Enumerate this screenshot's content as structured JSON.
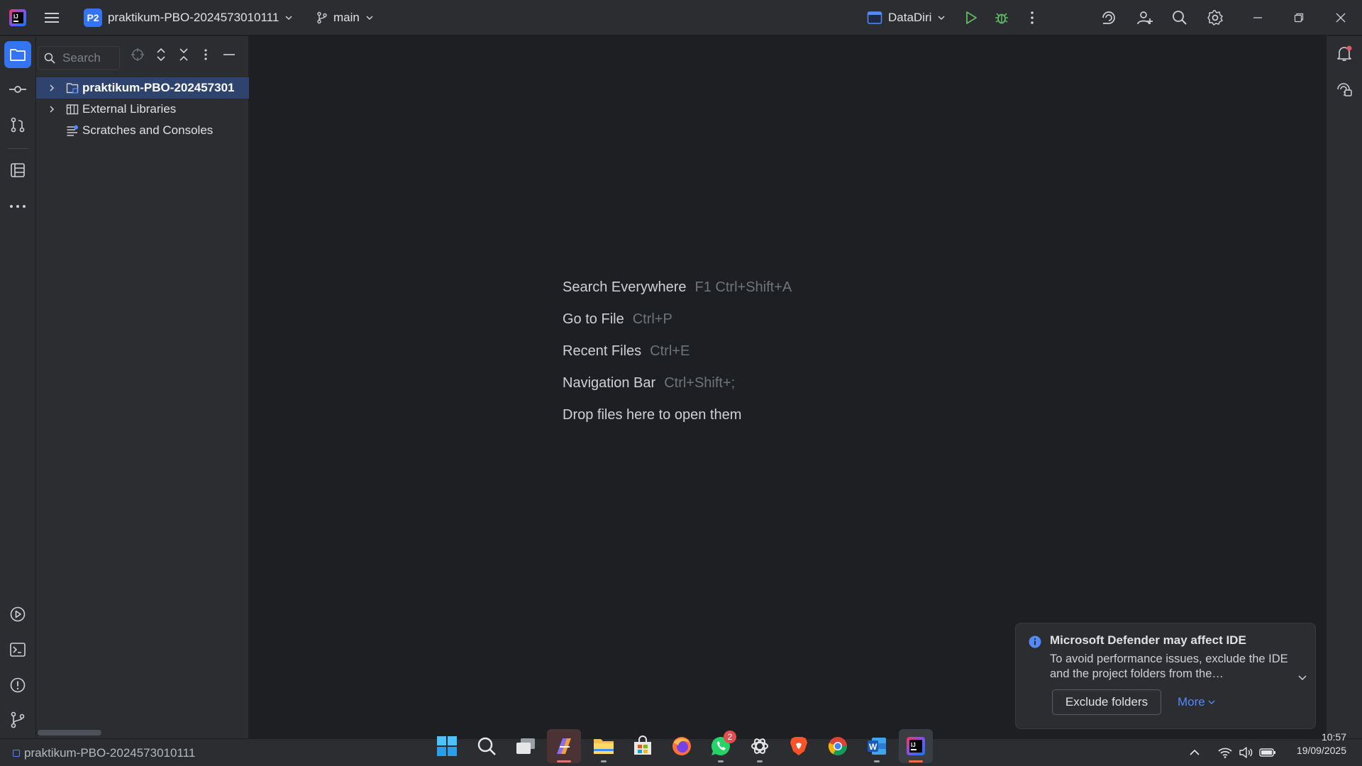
{
  "titlebar": {
    "project_badge": "P2",
    "project_name": "praktikum-PBO-2024573010111",
    "branch": "main",
    "run_config": "DataDiri"
  },
  "project_panel": {
    "search_placeholder": "Search",
    "tree": [
      {
        "label": "praktikum-PBO-202457301",
        "icon": "module-folder-icon",
        "expandable": true,
        "selected": true
      },
      {
        "label": "External Libraries",
        "icon": "libraries-icon",
        "expandable": true,
        "selected": false
      },
      {
        "label": "Scratches and Consoles",
        "icon": "scratches-icon",
        "expandable": false,
        "selected": false
      }
    ]
  },
  "editor": {
    "hints": [
      {
        "action": "Search Everywhere",
        "shortcut": "F1 Ctrl+Shift+A"
      },
      {
        "action": "Go to File",
        "shortcut": "Ctrl+P"
      },
      {
        "action": "Recent Files",
        "shortcut": "Ctrl+E"
      },
      {
        "action": "Navigation Bar",
        "shortcut": "Ctrl+Shift+;"
      },
      {
        "action": "Drop files here to open them",
        "shortcut": ""
      }
    ]
  },
  "notification": {
    "title": "Microsoft Defender may affect IDE",
    "body": "To avoid performance issues, exclude the IDE and the project folders from the…",
    "primary_button": "Exclude folders",
    "more_link": "More"
  },
  "statusbar": {
    "path": "praktikum-PBO-2024573010111"
  },
  "taskbar": {
    "whatsapp_badge": "2",
    "time": "10:57",
    "date": "19/09/2025"
  },
  "colors": {
    "accent": "#3574f0",
    "background": "#1e1f22",
    "panel": "#2b2d30",
    "run_green": "#5fb865",
    "link": "#548af7"
  }
}
